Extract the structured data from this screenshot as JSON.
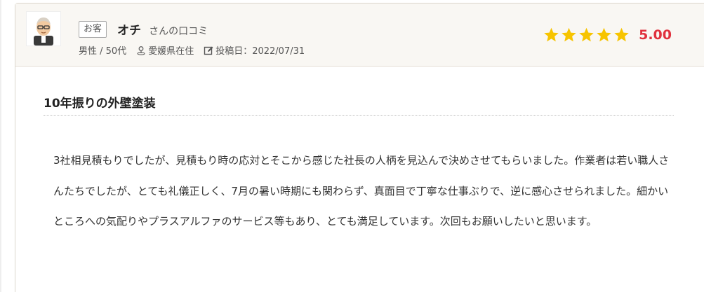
{
  "review": {
    "badge": "お客",
    "name": "オチ",
    "name_suffix": "さんの口コミ",
    "gender_age": "男性 / 50代",
    "location": "愛媛県在住",
    "posted": "投稿日：2022/07/31",
    "stars": 5,
    "score": "5.00",
    "title": "10年振りの外壁塗装",
    "body": "3社相見積もりでしたが、見積もり時の応対とそこから感じた社長の人柄を見込んで決めさせてもらいました。作業者は若い職人さんたちでしたが、とても礼儀正しく、7月の暑い時期にも関わらず、真面目で丁寧な仕事ぶりで、逆に感心させられました。細かいところへの気配りやプラスアルファのサービス等もあり、とても満足しています。次回もお願いしたいと思います。"
  },
  "icons": {
    "avatar": "avatar-illustration",
    "location": "map-pin-icon",
    "posted": "edit-icon",
    "star": "star-icon"
  },
  "colors": {
    "header_bg": "#f9f7f3",
    "star": "#f7c400",
    "score": "#e0313d"
  }
}
